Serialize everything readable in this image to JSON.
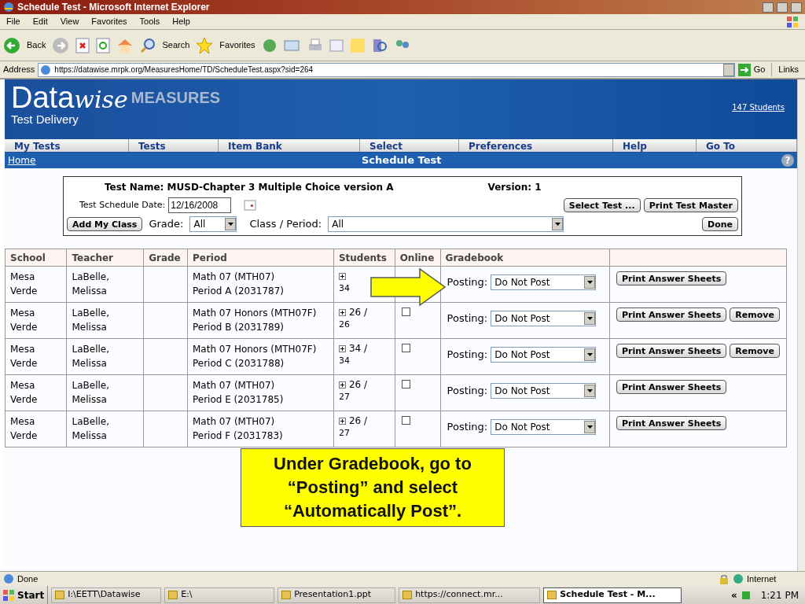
{
  "window": {
    "title": "Schedule Test - Microsoft Internet Explorer"
  },
  "menu": [
    "File",
    "Edit",
    "View",
    "Favorites",
    "Tools",
    "Help"
  ],
  "toolbar": {
    "back": "Back",
    "search": "Search",
    "favorites": "Favorites"
  },
  "address": {
    "label": "Address",
    "value": "https://datawise.mrpk.org/MeasuresHome/TD/ScheduleTest.aspx?sid=264",
    "go": "Go",
    "links": "Links"
  },
  "header": {
    "logo_a": "Data",
    "logo_b": "wise",
    "logo_c": "MEASURES",
    "subtitle": "Test Delivery",
    "students_link": "147 Students"
  },
  "nav": [
    "My Tests",
    "Tests",
    "Item Bank",
    "Select",
    "Preferences",
    "Help",
    "Go To"
  ],
  "subbar": {
    "home": "Home",
    "title": "Schedule Test",
    "help": "?"
  },
  "form": {
    "test_name": "Test Name: MUSD-Chapter 3 Multiple Choice version A",
    "version": "Version: 1",
    "date_label": "Test Schedule Date:",
    "date": "12/16/2008",
    "select_test": "Select Test ...",
    "print_master": "Print Test Master",
    "add_class": "Add My Class",
    "grade_label": "Grade:",
    "grade": "All",
    "class_label": "Class / Period:",
    "class": "All",
    "done": "Done"
  },
  "table": {
    "columns": [
      "School",
      "Teacher",
      "Grade",
      "Period",
      "Students",
      "Online",
      "Gradebook"
    ],
    "rows": [
      {
        "school": "Mesa Verde",
        "teacher": "LaBelle, Melissa",
        "period": [
          "Math 07 (MTH07)",
          "Period A (2031787)"
        ],
        "total": "34",
        "posting_label": "Posting:",
        "posting": "Do Not Post",
        "print": "Print Answer Sheets"
      },
      {
        "school": "Mesa Verde",
        "teacher": "LaBelle, Melissa",
        "period": [
          "Math 07 Honors (MTH07F)",
          "Period B (2031789)"
        ],
        "enrolled": "26 /",
        "total": "26",
        "online": false,
        "posting_label": "Posting:",
        "posting": "Do Not Post",
        "print": "Print Answer Sheets",
        "remove": "Remove"
      },
      {
        "school": "Mesa Verde",
        "teacher": "LaBelle, Melissa",
        "period": [
          "Math 07 Honors (MTH07F)",
          "Period C (2031788)"
        ],
        "enrolled": "34 /",
        "total": "34",
        "online": false,
        "posting_label": "Posting:",
        "posting": "Do Not Post",
        "print": "Print Answer Sheets",
        "remove": "Remove"
      },
      {
        "school": "Mesa Verde",
        "teacher": "LaBelle, Melissa",
        "period": [
          "Math 07 (MTH07)",
          "Period E (2031785)"
        ],
        "enrolled": "26 /",
        "total": "27",
        "online": false,
        "posting_label": "Posting:",
        "posting": "Do Not Post",
        "print": "Print Answer Sheets"
      },
      {
        "school": "Mesa Verde",
        "teacher": "LaBelle, Melissa",
        "period": [
          "Math 07 (MTH07)",
          "Period F (2031783)"
        ],
        "enrolled": "26 /",
        "total": "27",
        "online": false,
        "posting_label": "Posting:",
        "posting": "Do Not Post",
        "print": "Print Answer Sheets"
      }
    ]
  },
  "callout": "Under Gradebook, go to “Posting” and select “Automatically Post”.",
  "status_bar": {
    "text": "Done",
    "zone": "Internet"
  },
  "taskbar": {
    "start": "Start",
    "tasks": [
      {
        "label": "I:\\EETT\\Datawise",
        "selected": false
      },
      {
        "label": "E:\\",
        "selected": false
      },
      {
        "label": "Presentation1.ppt",
        "selected": false
      },
      {
        "label": "https://connect.mr...",
        "selected": false
      },
      {
        "label": "Schedule Test - M...",
        "selected": true
      }
    ],
    "tray_chevron": "«",
    "clock": "1:21 PM"
  }
}
